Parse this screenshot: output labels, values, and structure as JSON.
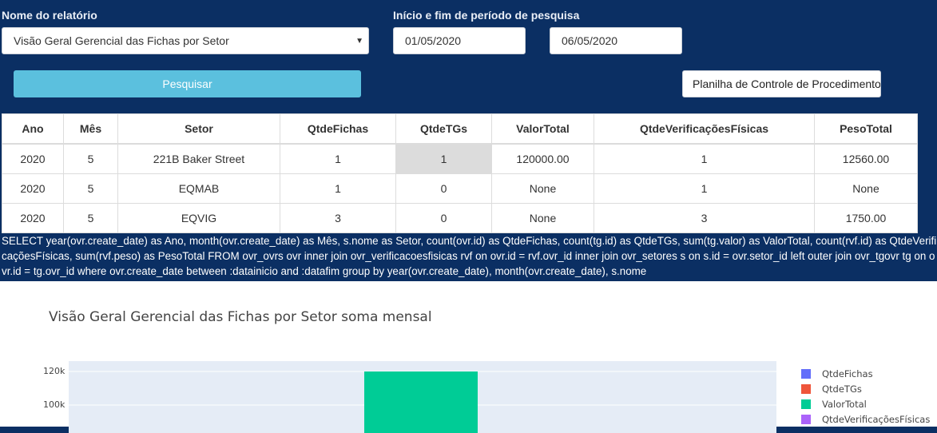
{
  "form": {
    "report_label": "Nome do relatório",
    "report_value": "Visão Geral Gerencial das Fichas por Setor",
    "period_label": "Início e fim de período de pesquisa",
    "start_date": "01/05/2020",
    "end_date": "06/05/2020",
    "search_button": "Pesquisar",
    "sheet_button": "Planilha de Controle de Procedimentos"
  },
  "table": {
    "headers": [
      "Ano",
      "Mês",
      "Setor",
      "QtdeFichas",
      "QtdeTGs",
      "ValorTotal",
      "QtdeVerificaçõesFísicas",
      "PesoTotal"
    ],
    "rows": [
      [
        "2020",
        "5",
        "221B Baker Street",
        "1",
        "1",
        "120000.00",
        "1",
        "12560.00"
      ],
      [
        "2020",
        "5",
        "EQMAB",
        "1",
        "0",
        "None",
        "1",
        "None"
      ],
      [
        "2020",
        "5",
        "EQVIG",
        "3",
        "0",
        "None",
        "3",
        "1750.00"
      ]
    ]
  },
  "sql": "SELECT year(ovr.create_date) as Ano, month(ovr.create_date) as Mês, s.nome as Setor, count(ovr.id) as QtdeFichas, count(tg.id) as QtdeTGs, sum(tg.valor) as ValorTotal, count(rvf.id) as QtdeVerificaçõesFísicas, sum(rvf.peso) as PesoTotal FROM ovr_ovrs ovr inner join ovr_verificacoesfisicas rvf on ovr.id = rvf.ovr_id inner join ovr_setores s on s.id = ovr.setor_id left outer join ovr_tgovr tg on ovr.id = tg.ovr_id where ovr.create_date between :datainicio and :datafim group by year(ovr.create_date), month(ovr.create_date), s.nome",
  "chart_data": {
    "type": "bar",
    "title": "Visão Geral Gerencial das Fichas por Setor soma mensal",
    "yticks": [
      "120k",
      "100k"
    ],
    "ylim_visible": [
      95000,
      123500
    ],
    "bar": {
      "series": "ValorTotal",
      "value": 120000,
      "color": "#00cc96"
    },
    "legend": [
      {
        "name": "QtdeFichas",
        "color": "#636efa"
      },
      {
        "name": "QtdeTGs",
        "color": "#ef553b"
      },
      {
        "name": "ValorTotal",
        "color": "#00cc96"
      },
      {
        "name": "QtdeVerificaçõesFísicas",
        "color": "#ab63fa"
      }
    ]
  }
}
